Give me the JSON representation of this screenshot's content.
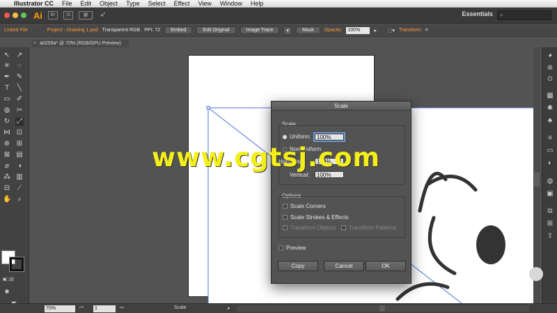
{
  "menubar": {
    "app_name": "Illustrator CC",
    "items": [
      "File",
      "Edit",
      "Object",
      "Type",
      "Select",
      "Effect",
      "View",
      "Window",
      "Help"
    ]
  },
  "appbar": {
    "logo": "Ai",
    "btn_br": "Br",
    "btn_st": "St",
    "workspace": "Essentials"
  },
  "control": {
    "linked_file": "Linked File",
    "file_name": "Project - Drawing 1.psd",
    "color_mode": "Transparent RGB",
    "ppi": "PPI: 72",
    "embed": "Embed",
    "edit_original": "Edit Original",
    "image_trace": "Image Trace",
    "mask": "Mask",
    "opacity_label": "Opacity:",
    "opacity_value": "100%",
    "transform": "Transform"
  },
  "document": {
    "tab_title": "a0206a* @ 70% (RGB/GPU Preview)"
  },
  "status": {
    "zoom": "70%",
    "page": "1",
    "tool": "Scale"
  },
  "dialog": {
    "title": "Scale",
    "scale_group": "Scale",
    "uniform_label": "Uniform:",
    "uniform_value": "100%",
    "non_uniform_label": "Non-Uniform",
    "horizontal_label": "Horizontal:",
    "horizontal_value": "100%",
    "vertical_label": "Vertical:",
    "vertical_value": "100%",
    "options_group": "Options",
    "scale_corners": "Scale Corners",
    "scale_strokes": "Scale Strokes & Effects",
    "transform_objects": "Transform Objects",
    "transform_patterns": "Transform Patterns",
    "preview": "Preview",
    "copy": "Copy",
    "cancel": "Cancel",
    "ok": "OK"
  },
  "watermark": "www.cgtsj.com",
  "colors": {
    "accent": "#ff9a00",
    "link": "#ff9a3a",
    "focus": "#6f9fd8",
    "watermark": "#f4ee1a"
  }
}
